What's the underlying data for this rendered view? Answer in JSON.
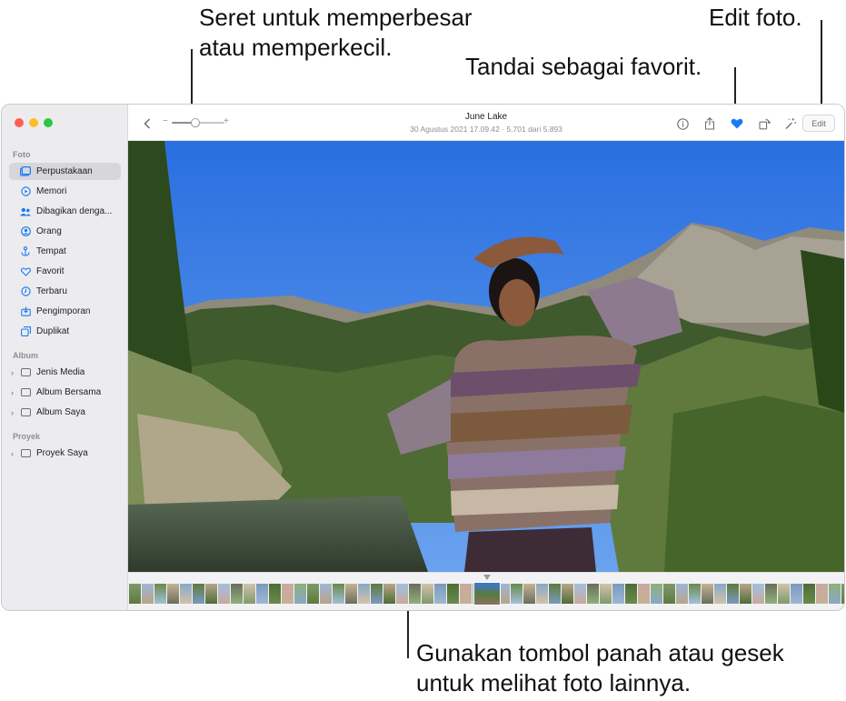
{
  "callouts": {
    "zoom": [
      "Seret untuk memperbesar",
      "atau memperkecil."
    ],
    "favorite": "Tandai sebagai favorit.",
    "edit": "Edit foto.",
    "browse": [
      "Gunakan tombol panah atau gesek",
      "untuk melihat foto lainnya."
    ]
  },
  "sidebar": {
    "section_photos": "Foto",
    "items": [
      {
        "label": "Perpustakaan",
        "icon": "library-icon",
        "selected": true
      },
      {
        "label": "Memori",
        "icon": "memories-icon"
      },
      {
        "label": "Dibagikan denga...",
        "icon": "shared-with-you-icon"
      },
      {
        "label": "Orang",
        "icon": "people-icon"
      },
      {
        "label": "Tempat",
        "icon": "places-icon"
      },
      {
        "label": "Favorit",
        "icon": "heart-icon"
      },
      {
        "label": "Terbaru",
        "icon": "recents-icon"
      },
      {
        "label": "Pengimporan",
        "icon": "imports-icon"
      },
      {
        "label": "Duplikat",
        "icon": "duplicates-icon"
      }
    ],
    "section_albums": "Album",
    "albums": [
      {
        "label": "Jenis Media",
        "icon": "folder-icon"
      },
      {
        "label": "Album Bersama",
        "icon": "shared-album-icon"
      },
      {
        "label": "Album Saya",
        "icon": "folder-icon"
      }
    ],
    "section_projects": "Proyek",
    "projects": [
      {
        "label": "Proyek Saya",
        "icon": "folder-icon"
      }
    ]
  },
  "toolbar": {
    "title": "June Lake",
    "subtitle": "30 Agustus 2021 17.09.42   ·   5.701 dari 5.893",
    "zoom_minus": "−",
    "zoom_plus": "+",
    "zoom_level": 0.45,
    "edit_label": "Edit"
  },
  "colors": {
    "accent": "#1a7cf5",
    "favorite": "#1a7cf5",
    "sky": "#2f78e8"
  }
}
